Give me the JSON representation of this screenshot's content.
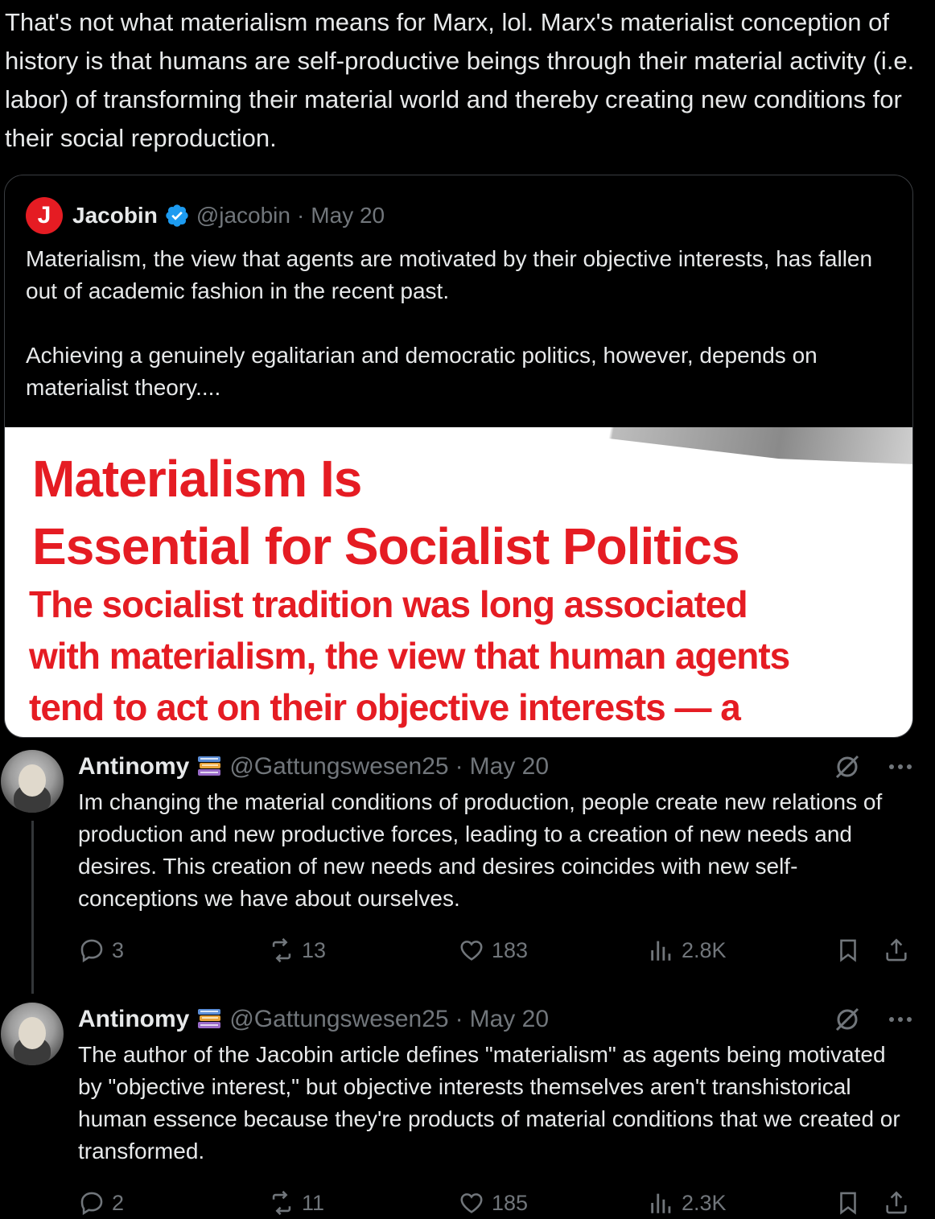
{
  "main_text": "That's not what materialism means for Marx, lol. Marx's materialist conception of history is that humans are self-productive beings through their material activity (i.e. labor) of transforming their material world and thereby creating new conditions for their social reproduction.",
  "quote": {
    "logo_letter": "J",
    "name": "Jacobin",
    "handle": "@jacobin",
    "sep": "·",
    "date": "May 20",
    "body": "Materialism, the view that agents are motivated by their objective interests, has fallen out of academic fashion in the recent past.\n\nAchieving a genuinely egalitarian and democratic politics, however, depends on materialist theory....",
    "image_headline": "Materialism Is\nEssential for Socialist Politics",
    "image_subhead": "The socialist tradition was long associated\nwith materialism, the view that human agents\ntend to act on their objective interests — a"
  },
  "replies": [
    {
      "name": "Antinomy",
      "handle": "@Gattungswesen25",
      "sep": "·",
      "date": "May 20",
      "body": "Im changing the material conditions of production, people create new relations of production and new productive forces, leading to a creation of new needs and desires. This creation of new needs and desires coincides with new self-conceptions we have about ourselves.",
      "replies_count": "3",
      "reposts_count": "13",
      "likes_count": "183",
      "views_count": "2.8K"
    },
    {
      "name": "Antinomy",
      "handle": "@Gattungswesen25",
      "sep": "·",
      "date": "May 20",
      "body": "The author of the Jacobin article defines  \"materialism\" as agents being motivated by \"objective interest,\" but objective interests themselves aren't transhistorical human essence because they're products of material conditions that we created or transformed.",
      "replies_count": "2",
      "reposts_count": "11",
      "likes_count": "185",
      "views_count": "2.3K"
    }
  ],
  "icons": {
    "verified": "verified-badge-icon",
    "books": "books-emoji-icon",
    "grok": "grok-icon",
    "more": "more-icon",
    "reply": "reply-icon",
    "repost": "repost-icon",
    "like": "like-icon",
    "views": "views-icon",
    "bookmark": "bookmark-icon",
    "share": "share-icon"
  },
  "colors": {
    "background": "#000000",
    "text": "#e7e9ea",
    "muted": "#71767b",
    "jacobin_red": "#e51c23",
    "verified_blue": "#1d9bf0"
  }
}
